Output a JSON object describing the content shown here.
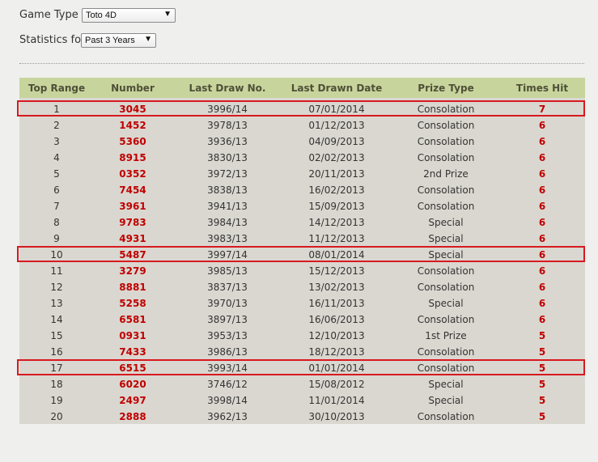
{
  "form": {
    "game_type_label": "Game Type",
    "game_type_value": "Toto 4D",
    "stats_label": "Statistics for",
    "stats_value": "Past 3 Years"
  },
  "table": {
    "headers": [
      "Top Range",
      "Number",
      "Last Draw No.",
      "Last Drawn Date",
      "Prize Type",
      "Times Hit"
    ],
    "rows": [
      [
        "1",
        "3045",
        "3996/14",
        "07/01/2014",
        "Consolation",
        "7"
      ],
      [
        "2",
        "1452",
        "3978/13",
        "01/12/2013",
        "Consolation",
        "6"
      ],
      [
        "3",
        "5360",
        "3936/13",
        "04/09/2013",
        "Consolation",
        "6"
      ],
      [
        "4",
        "8915",
        "3830/13",
        "02/02/2013",
        "Consolation",
        "6"
      ],
      [
        "5",
        "0352",
        "3972/13",
        "20/11/2013",
        "2nd Prize",
        "6"
      ],
      [
        "6",
        "7454",
        "3838/13",
        "16/02/2013",
        "Consolation",
        "6"
      ],
      [
        "7",
        "3961",
        "3941/13",
        "15/09/2013",
        "Consolation",
        "6"
      ],
      [
        "8",
        "9783",
        "3984/13",
        "14/12/2013",
        "Special",
        "6"
      ],
      [
        "9",
        "4931",
        "3983/13",
        "11/12/2013",
        "Special",
        "6"
      ],
      [
        "10",
        "5487",
        "3997/14",
        "08/01/2014",
        "Special",
        "6"
      ],
      [
        "11",
        "3279",
        "3985/13",
        "15/12/2013",
        "Consolation",
        "6"
      ],
      [
        "12",
        "8881",
        "3837/13",
        "13/02/2013",
        "Consolation",
        "6"
      ],
      [
        "13",
        "5258",
        "3970/13",
        "16/11/2013",
        "Special",
        "6"
      ],
      [
        "14",
        "6581",
        "3897/13",
        "16/06/2013",
        "Consolation",
        "6"
      ],
      [
        "15",
        "0931",
        "3953/13",
        "12/10/2013",
        "1st Prize",
        "5"
      ],
      [
        "16",
        "7433",
        "3986/13",
        "18/12/2013",
        "Consolation",
        "5"
      ],
      [
        "17",
        "6515",
        "3993/14",
        "01/01/2014",
        "Consolation",
        "5"
      ],
      [
        "18",
        "6020",
        "3746/12",
        "15/08/2012",
        "Special",
        "5"
      ],
      [
        "19",
        "2497",
        "3998/14",
        "11/01/2014",
        "Special",
        "5"
      ],
      [
        "20",
        "2888",
        "3962/13",
        "30/10/2013",
        "Consolation",
        "5"
      ]
    ],
    "highlighted_rows": [
      1,
      10,
      17
    ]
  },
  "colors": {
    "header_bg": "#c7d59d",
    "table_bg": "#dad7d0",
    "number_red": "#c00000",
    "highlight_border": "#d71920"
  },
  "icons": {
    "dropdown": "chevron-down-icon"
  }
}
